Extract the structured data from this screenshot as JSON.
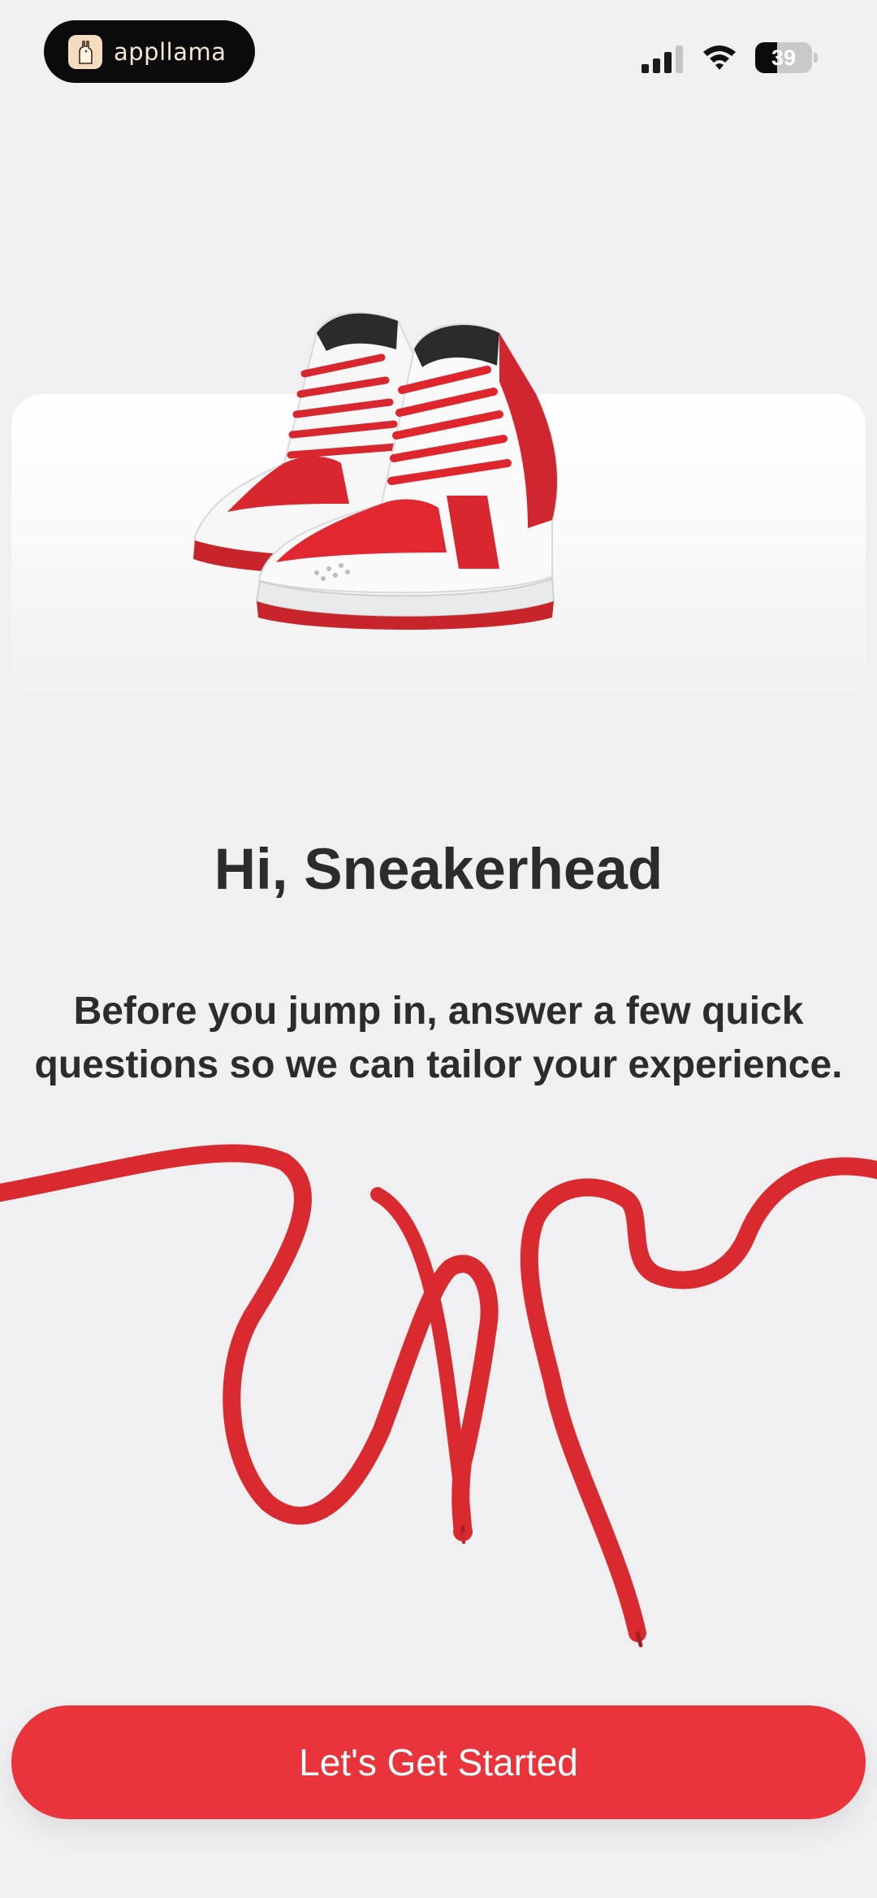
{
  "status_bar": {
    "brand_name": "appllama",
    "battery_level": "39",
    "battery_fraction": 0.39
  },
  "onboarding": {
    "greeting": "Hi, Sneakerhead",
    "intro": "Before you jump in, answer a few quick questions so we can tailor your experience.",
    "cta_label": "Let's Get Started"
  },
  "icons": {
    "logo": "llama-logo-icon",
    "signal": "cellular-signal-icon",
    "wifi": "wifi-icon",
    "battery": "battery-icon"
  },
  "colors": {
    "background": "#f0eff1",
    "accent": "#e8343a",
    "text": "#2c2c2e",
    "pill": "#0b0b0b"
  }
}
